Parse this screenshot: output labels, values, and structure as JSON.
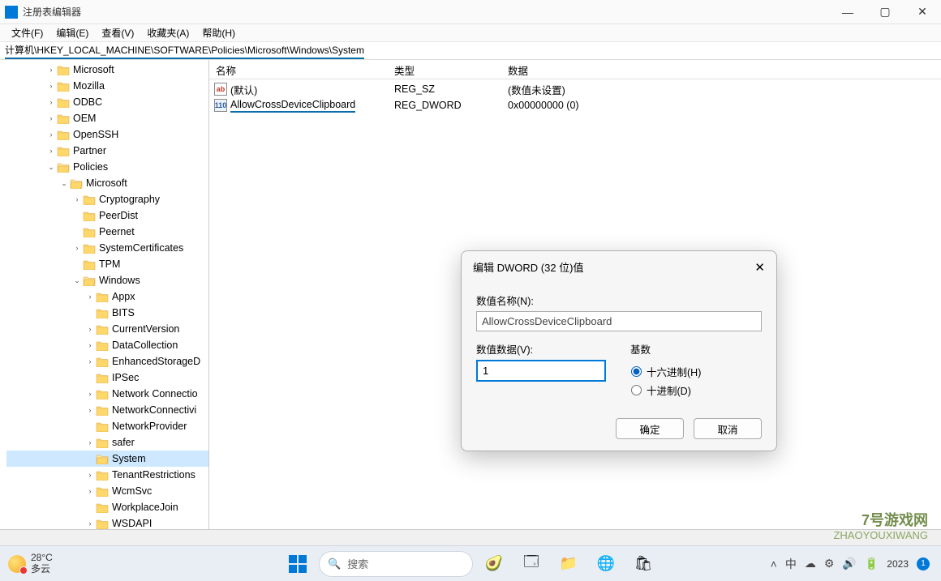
{
  "window": {
    "title": "注册表编辑器",
    "min_label": "—",
    "max_label": "▢",
    "close_label": "✕"
  },
  "menu": {
    "file": "文件(F)",
    "edit": "编辑(E)",
    "view": "查看(V)",
    "favorites": "收藏夹(A)",
    "help": "帮助(H)"
  },
  "path": "计算机\\HKEY_LOCAL_MACHINE\\SOFTWARE\\Policies\\Microsoft\\Windows\\System",
  "tree": [
    {
      "indent": 3,
      "exp": ">",
      "label": "Microsoft"
    },
    {
      "indent": 3,
      "exp": ">",
      "label": "Mozilla"
    },
    {
      "indent": 3,
      "exp": ">",
      "label": "ODBC"
    },
    {
      "indent": 3,
      "exp": ">",
      "label": "OEM"
    },
    {
      "indent": 3,
      "exp": ">",
      "label": "OpenSSH"
    },
    {
      "indent": 3,
      "exp": ">",
      "label": "Partner"
    },
    {
      "indent": 3,
      "exp": "v",
      "label": "Policies",
      "open": true
    },
    {
      "indent": 4,
      "exp": "v",
      "label": "Microsoft",
      "open": true
    },
    {
      "indent": 5,
      "exp": ">",
      "label": "Cryptography"
    },
    {
      "indent": 5,
      "exp": "",
      "label": "PeerDist"
    },
    {
      "indent": 5,
      "exp": "",
      "label": "Peernet"
    },
    {
      "indent": 5,
      "exp": ">",
      "label": "SystemCertificates"
    },
    {
      "indent": 5,
      "exp": "",
      "label": "TPM"
    },
    {
      "indent": 5,
      "exp": "v",
      "label": "Windows",
      "open": true
    },
    {
      "indent": 6,
      "exp": ">",
      "label": "Appx"
    },
    {
      "indent": 6,
      "exp": "",
      "label": "BITS"
    },
    {
      "indent": 6,
      "exp": ">",
      "label": "CurrentVersion"
    },
    {
      "indent": 6,
      "exp": ">",
      "label": "DataCollection"
    },
    {
      "indent": 6,
      "exp": ">",
      "label": "EnhancedStorageD"
    },
    {
      "indent": 6,
      "exp": "",
      "label": "IPSec"
    },
    {
      "indent": 6,
      "exp": ">",
      "label": "Network Connectio"
    },
    {
      "indent": 6,
      "exp": ">",
      "label": "NetworkConnectivi"
    },
    {
      "indent": 6,
      "exp": "",
      "label": "NetworkProvider"
    },
    {
      "indent": 6,
      "exp": ">",
      "label": "safer"
    },
    {
      "indent": 6,
      "exp": "",
      "label": "System",
      "selected": true,
      "open": true
    },
    {
      "indent": 6,
      "exp": ">",
      "label": "TenantRestrictions"
    },
    {
      "indent": 6,
      "exp": ">",
      "label": "WcmSvc"
    },
    {
      "indent": 6,
      "exp": "",
      "label": "WorkplaceJoin"
    },
    {
      "indent": 6,
      "exp": ">",
      "label": "WSDAPI"
    }
  ],
  "list": {
    "header": {
      "name": "名称",
      "type": "类型",
      "data": "数据"
    },
    "rows": [
      {
        "icon": "str",
        "name": "(默认)",
        "type": "REG_SZ",
        "data": "(数值未设置)",
        "hl": false
      },
      {
        "icon": "bin",
        "name": "AllowCrossDeviceClipboard",
        "type": "REG_DWORD",
        "data": "0x00000000 (0)",
        "hl": true
      }
    ]
  },
  "dialog": {
    "title": "编辑 DWORD (32 位)值",
    "name_label": "数值名称(N):",
    "name_value": "AllowCrossDeviceClipboard",
    "data_label": "数值数据(V):",
    "data_value": "1",
    "base_label": "基数",
    "radio_hex": "十六进制(H)",
    "radio_dec": "十进制(D)",
    "ok": "确定",
    "cancel": "取消"
  },
  "taskbar": {
    "weather_temp": "28°C",
    "weather_desc": "多云",
    "search_placeholder": "搜索",
    "ime": "中",
    "year": "2023",
    "badge": "1"
  },
  "watermark": {
    "line1": "7号游戏网",
    "line2": "ZHAOYOUXIWANG"
  }
}
